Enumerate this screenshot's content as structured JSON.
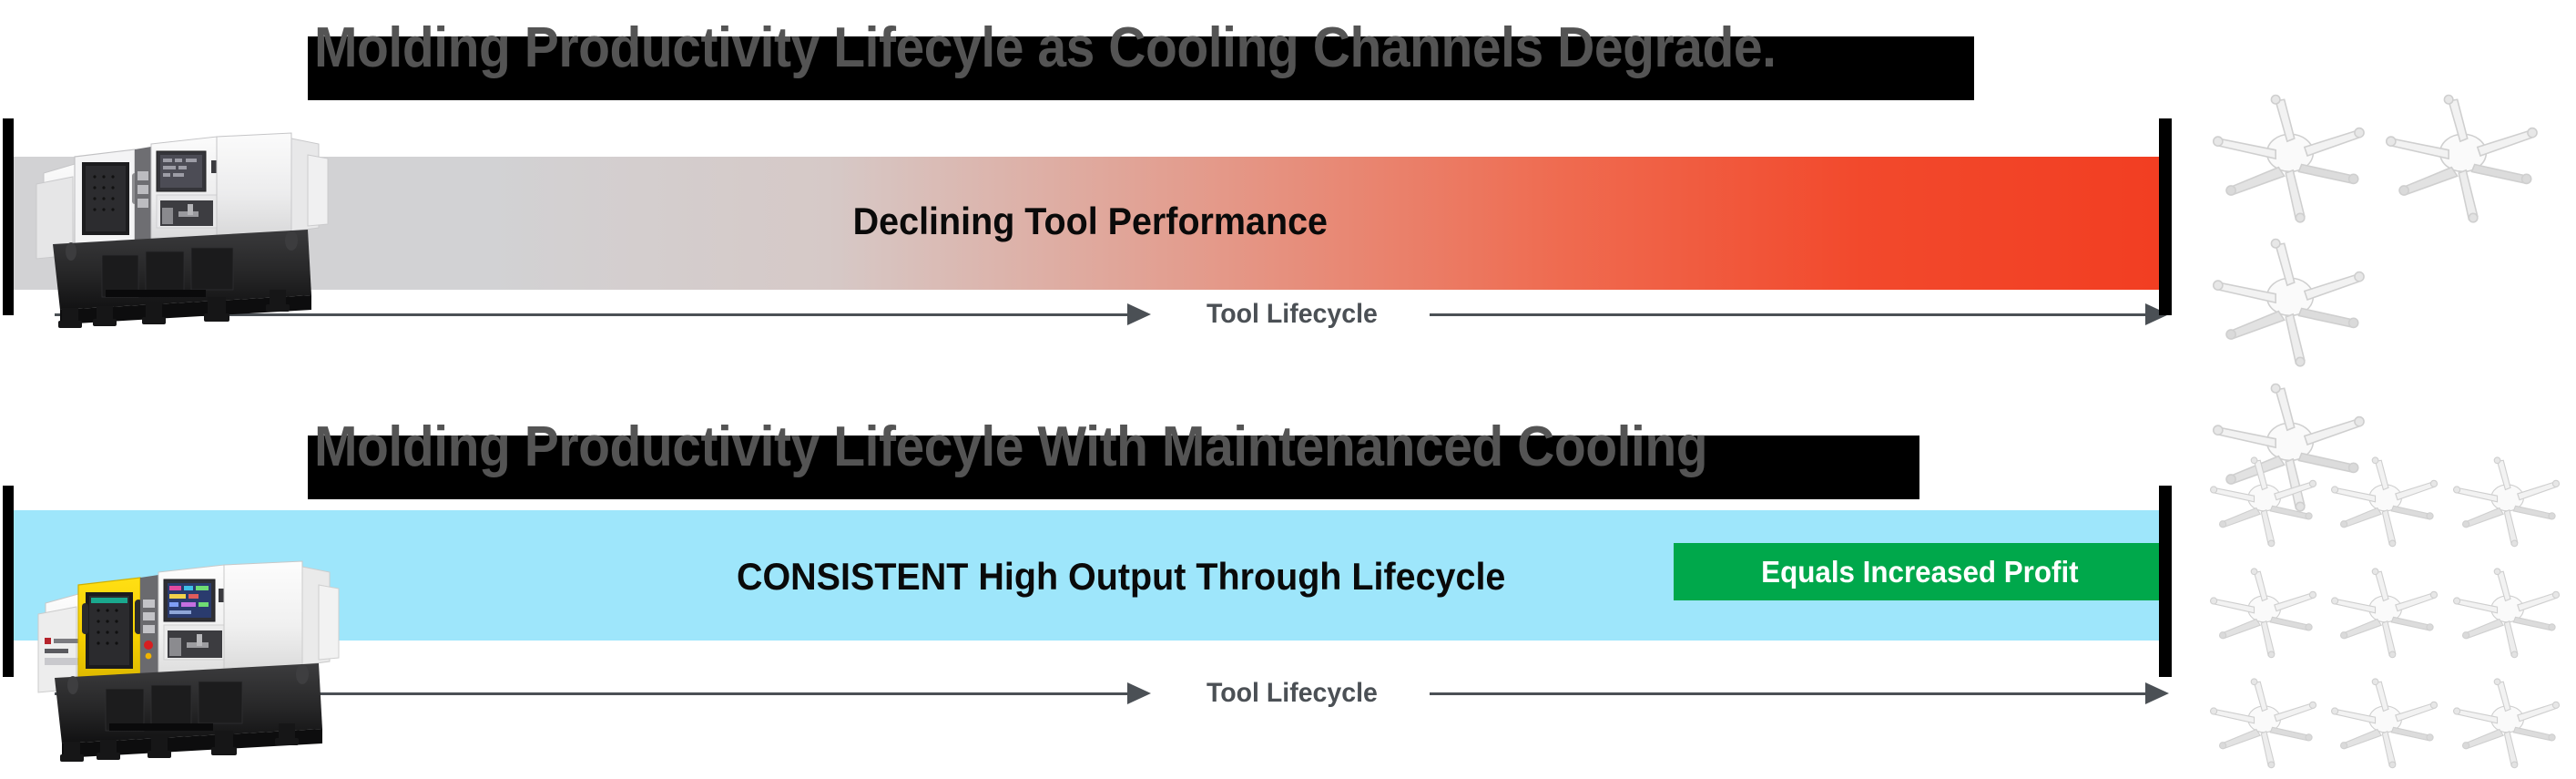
{
  "sections": [
    {
      "id": "degrading",
      "title": "Molding Productivity Lifecyle as Cooling Channels Degrade.",
      "bar_label": "Declining Tool Performance",
      "axis_label": "Tool Lifecycle",
      "bar_start_color": "#d2d2d4",
      "bar_end_color": "#f23e22",
      "machine_name": "grayscale-injection-molding-machine",
      "parts_count": 4,
      "parts_layout": [
        [
          1,
          1
        ],
        [
          1,
          0
        ],
        [
          1,
          0
        ]
      ]
    },
    {
      "id": "maintained",
      "title": "Molding Productivity Lifecyle With Maintenanced Cooling",
      "bar_label": "CONSISTENT High Output Through Lifecycle",
      "axis_label": "Tool Lifecycle",
      "bar_color": "#9ee6fb",
      "badge_label": "Equals Increased Profit",
      "badge_color": "#00a84b",
      "machine_name": "fanuc-roboshot-injection-molding-machine",
      "parts_count": 9,
      "parts_layout": [
        [
          1,
          1,
          1
        ],
        [
          1,
          1,
          1
        ],
        [
          1,
          1,
          1
        ]
      ]
    }
  ],
  "colors": {
    "title_bar": "#000000",
    "title_text": "#545454",
    "endcap": "#000000",
    "axis": "#4b5055",
    "bar_label_text": "#0a0a0a",
    "badge_text": "#ffffff"
  }
}
